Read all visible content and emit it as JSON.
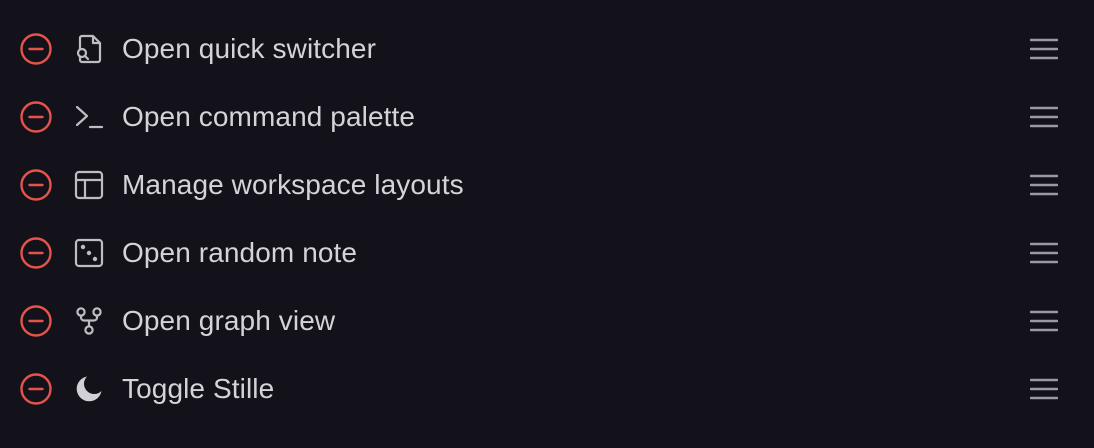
{
  "colors": {
    "background": "#13121a",
    "text": "#d4d4d8",
    "remove": "#e5534b",
    "icon": "#bdbdc4",
    "handle": "#9a9aa3"
  },
  "commands": [
    {
      "label": "Open quick switcher",
      "icon": "file-search-icon"
    },
    {
      "label": "Open command palette",
      "icon": "terminal-icon"
    },
    {
      "label": "Manage workspace layouts",
      "icon": "layout-icon"
    },
    {
      "label": "Open random note",
      "icon": "dice-icon"
    },
    {
      "label": "Open graph view",
      "icon": "git-fork-icon"
    },
    {
      "label": "Toggle Stille",
      "icon": "moon-icon"
    }
  ]
}
